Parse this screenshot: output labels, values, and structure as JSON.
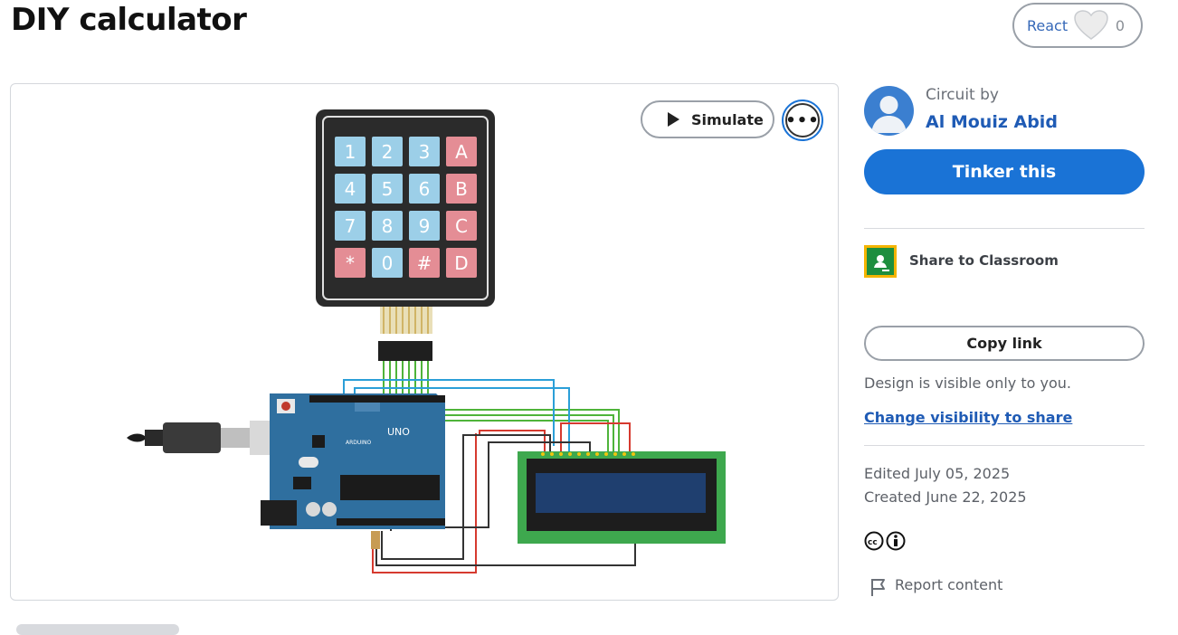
{
  "page": {
    "title": "DIY calculator"
  },
  "react": {
    "label": "React",
    "count": "0"
  },
  "canvas": {
    "simulate_label": "Simulate",
    "more_label": "•••",
    "keypad_keys": [
      "1",
      "2",
      "3",
      "A",
      "4",
      "5",
      "6",
      "B",
      "7",
      "8",
      "9",
      "C",
      "*",
      "0",
      "#",
      "D"
    ],
    "arduino_label": "UNO",
    "arduino_brand": "ARDUINO"
  },
  "sidebar": {
    "circuit_by": "Circuit by",
    "author": "Al Mouiz Abid",
    "tinker_label": "Tinker this",
    "share_classroom": "Share to Classroom",
    "copy_link": "Copy link",
    "visibility_note": "Design is visible only to you.",
    "change_visibility": "Change visibility to share",
    "edited": "Edited July 05, 2025",
    "created": "Created June 22, 2025",
    "report": "Report content"
  },
  "colors": {
    "primary": "#1a73d6",
    "link": "#1f5bb5",
    "keypad_blue": "#9ccfe8",
    "keypad_red": "#e48d95",
    "arduino_blue": "#2f6f9f",
    "lcd_green": "#3ea84e"
  }
}
